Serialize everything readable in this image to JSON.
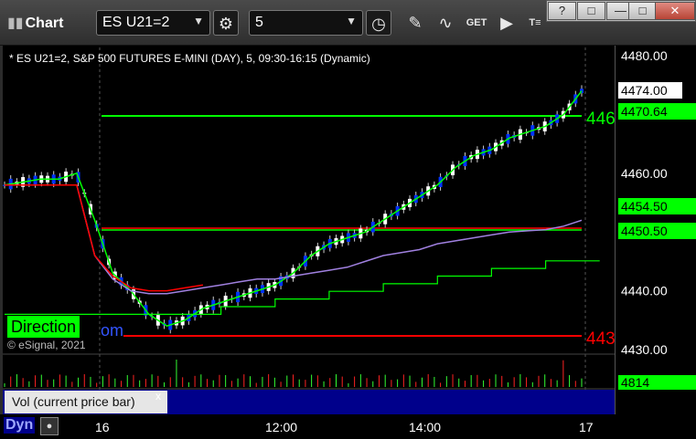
{
  "toolbar": {
    "title": "Chart",
    "symbol": "ES U21=2",
    "interval": "5"
  },
  "window_controls": {
    "help": "?",
    "restore": "□",
    "minimize": "—",
    "maximize": "□",
    "close": "✕"
  },
  "chart_header": "* ES U21=2, S&P 500 FUTURES E-MINI (DAY), 5, 09:30-16:15 (Dynamic)",
  "watermark": "© eSignal, 2021",
  "direction_label": "Direction",
  "direction_suffix": "om",
  "price_axis": {
    "ticks": [
      "4480.00",
      "4470.00",
      "4460.00",
      "4450.00",
      "4440.00",
      "4430.00"
    ],
    "last_price": "4474.00",
    "labels": [
      {
        "text": "4470.64",
        "color": "#00ff00"
      },
      {
        "text": "4454.50",
        "color": "#00ff00"
      },
      {
        "text": "4450.50",
        "color": "#00ff00"
      }
    ],
    "line_tag_upper": "446",
    "line_tag_lower": "443"
  },
  "volume": {
    "value": "4814",
    "label": "Vol (current price bar)",
    "close": "x"
  },
  "time_axis": [
    "16",
    "12:00",
    "14:00",
    "17"
  ],
  "footer": {
    "mode": "Dyn"
  },
  "colors": {
    "up_candle": "#ffffff",
    "down_candle": "#0033ff",
    "green_line": "#00ff00",
    "red_line": "#ff0000",
    "purple_line": "#a080e0"
  },
  "chart_data": {
    "type": "line",
    "title": "* ES U21=2, S&P 500 FUTURES E-MINI (DAY), 5, 09:30-16:15 (Dynamic)",
    "ylim": [
      4430,
      4482
    ],
    "series": [
      {
        "values": [
          4458,
          4458.5,
          4459,
          4459,
          4460,
          4452,
          4443,
          4440,
          4436,
          4434,
          4435,
          4437,
          4438,
          4439,
          4440,
          4441,
          4443,
          4446,
          4448,
          4449,
          4450,
          4452,
          4454,
          4456,
          4458,
          4461,
          4463,
          4464,
          4466,
          4467,
          4468,
          4470,
          4474
        ]
      },
      {
        "values": [
          4458,
          4458,
          4458,
          4458,
          4458,
          4446,
          4442,
          4440,
          4439.5,
          4439.5,
          4440,
          4440.5,
          4441,
          4441.5,
          4442,
          4442,
          4442.5,
          4443,
          4443.5,
          4444,
          4445,
          4446,
          4446.5,
          4447,
          4448,
          4448.5,
          4449,
          4449.5,
          4450,
          4450.2,
          4450.4,
          4451,
          4452
        ]
      }
    ]
  }
}
